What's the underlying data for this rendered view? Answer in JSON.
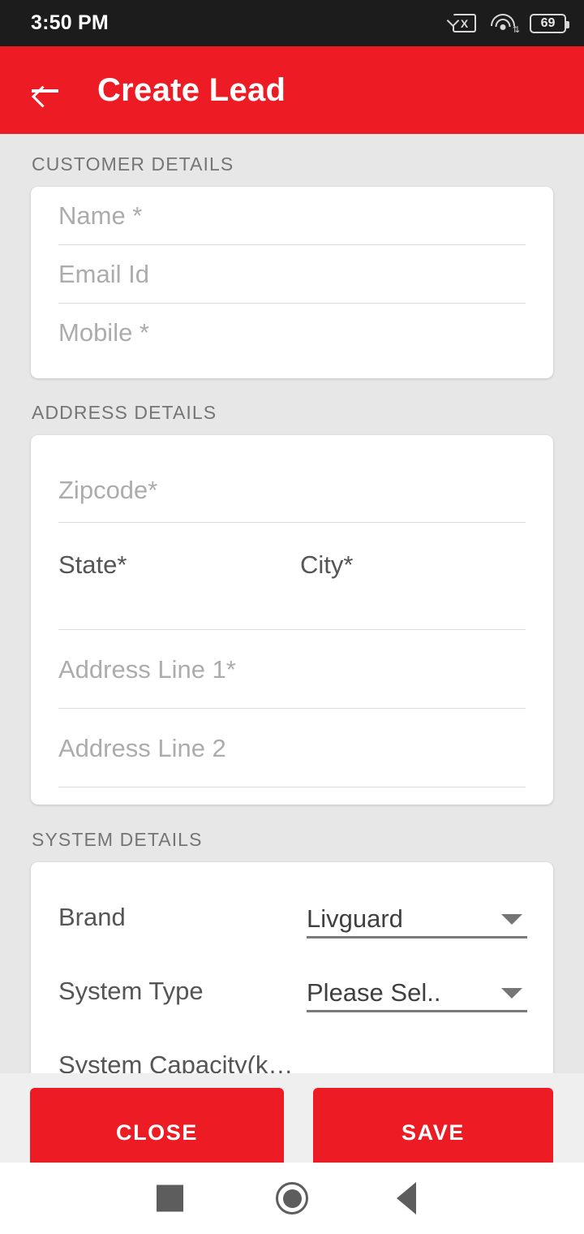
{
  "statusbar": {
    "time": "3:50 PM",
    "sim_icon": "sim-card-x-icon",
    "sim_glyph": "X",
    "wifi_icon": "wifi-icon",
    "wifi_data_glyph": "⇅",
    "battery_icon": "battery-icon",
    "battery_level": "69"
  },
  "appbar": {
    "back_icon": "arrow-left-icon",
    "title": "Create Lead",
    "color": "#ED1C24"
  },
  "sections": {
    "customer": {
      "label": "CUSTOMER DETAILS",
      "fields": [
        {
          "placeholder": "Name *",
          "value": ""
        },
        {
          "placeholder": "Email Id",
          "value": ""
        },
        {
          "placeholder": "Mobile *",
          "value": ""
        }
      ]
    },
    "address": {
      "label": "ADDRESS DETAILS",
      "zipcode": {
        "placeholder": "Zipcode*",
        "value": ""
      },
      "state": {
        "label": "State*",
        "value": ""
      },
      "city": {
        "label": "City*",
        "value": ""
      },
      "line1": {
        "placeholder": "Address Line 1*",
        "value": ""
      },
      "line2": {
        "placeholder": "Address Line 2",
        "value": ""
      }
    },
    "system": {
      "label": "SYSTEM DETAILS",
      "brand": {
        "label": "Brand",
        "value": "Livguard",
        "caret": "chevron-down-icon"
      },
      "system_type": {
        "label": "System Type",
        "value": "Please Sel..",
        "caret": "chevron-down-icon"
      },
      "capacity": {
        "label": "System Capacity(k…",
        "value": ""
      }
    }
  },
  "footer": {
    "close_label": "CLOSE",
    "save_label": "SAVE"
  },
  "navbar": {
    "recents_icon": "square-recents-icon",
    "home_icon": "circle-home-icon",
    "back_icon": "triangle-back-icon"
  }
}
